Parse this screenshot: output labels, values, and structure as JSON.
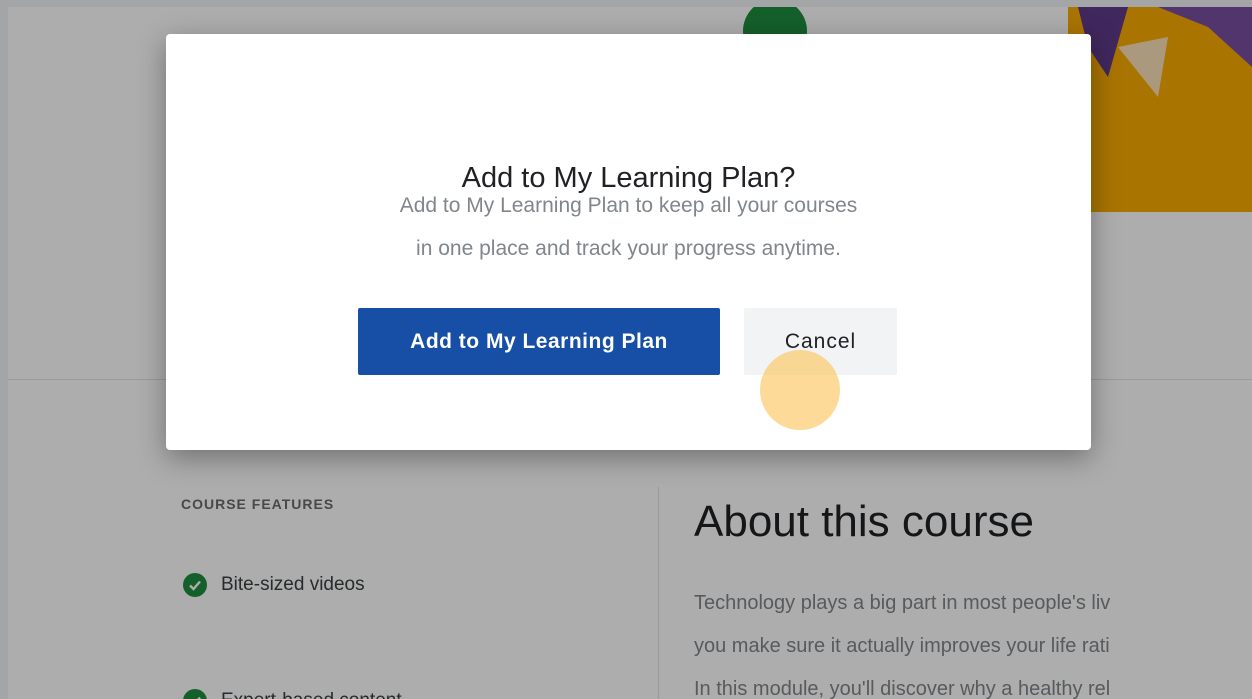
{
  "dialog": {
    "title": "Add to My Learning Plan?",
    "description_line1": "Add to My Learning Plan to keep all your courses",
    "description_line2": "in one place and track your progress anytime.",
    "primary_button_label": "Add to My Learning Plan",
    "cancel_button_label": "Cancel"
  },
  "page": {
    "features": {
      "title": "COURSE FEATURES",
      "items": [
        "Bite-sized videos",
        "Expert-based content"
      ]
    },
    "about": {
      "title": "About this course",
      "lines": [
        "Technology plays a big part in most people's liv",
        "you make sure it actually improves your life rati",
        "In this module, you'll discover why a healthy rel"
      ]
    }
  },
  "icons": {
    "feature_icon": "check-circle-icon"
  },
  "colors": {
    "primary_button": "#174ea6",
    "cancel_button": "#f1f3f4",
    "check_green": "#1e8e3e",
    "hero_orange": "#f9ab00",
    "click_highlight": "#fcc458"
  }
}
